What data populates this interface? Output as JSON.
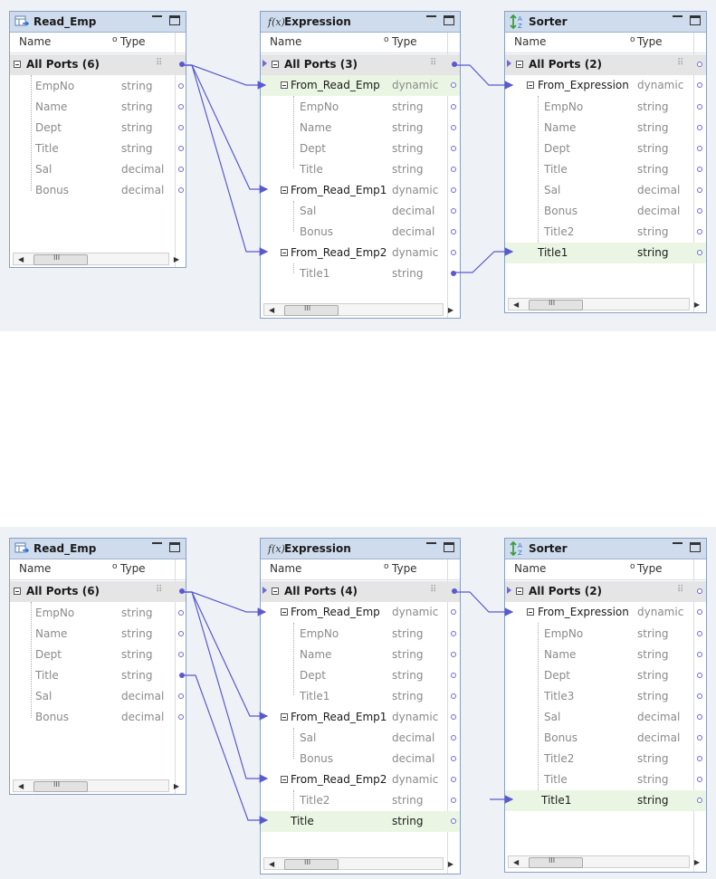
{
  "diagrams": [
    {
      "source": {
        "title": "Read_Emp",
        "header": {
          "name": "Name",
          "type": "Type"
        },
        "group": "All Ports (6)",
        "ports": [
          {
            "name": "EmpNo",
            "type": "string"
          },
          {
            "name": "Name",
            "type": "string"
          },
          {
            "name": "Dept",
            "type": "string"
          },
          {
            "name": "Title",
            "type": "string"
          },
          {
            "name": "Sal",
            "type": "decimal"
          },
          {
            "name": "Bonus",
            "type": "decimal"
          }
        ],
        "scroll_glyph": "III"
      },
      "expression": {
        "title": "Expression",
        "header": {
          "name": "Name",
          "type": "Type"
        },
        "group": "All Ports (3)",
        "rows": [
          {
            "name": "From_Read_Emp",
            "type": "dynamic"
          },
          {
            "name": "EmpNo",
            "type": "string"
          },
          {
            "name": "Name",
            "type": "string"
          },
          {
            "name": "Dept",
            "type": "string"
          },
          {
            "name": "Title",
            "type": "string"
          },
          {
            "name": "From_Read_Emp1",
            "type": "dynamic"
          },
          {
            "name": "Sal",
            "type": "decimal"
          },
          {
            "name": "Bonus",
            "type": "decimal"
          },
          {
            "name": "From_Read_Emp2",
            "type": "dynamic"
          },
          {
            "name": "Title1",
            "type": "string"
          }
        ],
        "scroll_glyph": "III"
      },
      "sorter": {
        "title": "Sorter",
        "header": {
          "name": "Name",
          "type": "Type"
        },
        "group": "All Ports (2)",
        "rows": [
          {
            "name": "From_Expression",
            "type": "dynamic"
          },
          {
            "name": "EmpNo",
            "type": "string"
          },
          {
            "name": "Name",
            "type": "string"
          },
          {
            "name": "Dept",
            "type": "string"
          },
          {
            "name": "Title",
            "type": "string"
          },
          {
            "name": "Sal",
            "type": "decimal"
          },
          {
            "name": "Bonus",
            "type": "decimal"
          },
          {
            "name": "Title2",
            "type": "string"
          },
          {
            "name": "Title1",
            "type": "string"
          }
        ],
        "scroll_glyph": "III"
      }
    },
    {
      "source": {
        "title": "Read_Emp",
        "header": {
          "name": "Name",
          "type": "Type"
        },
        "group": "All Ports (6)",
        "ports": [
          {
            "name": "EmpNo",
            "type": "string"
          },
          {
            "name": "Name",
            "type": "string"
          },
          {
            "name": "Dept",
            "type": "string"
          },
          {
            "name": "Title",
            "type": "string"
          },
          {
            "name": "Sal",
            "type": "decimal"
          },
          {
            "name": "Bonus",
            "type": "decimal"
          }
        ],
        "scroll_glyph": "III"
      },
      "expression": {
        "title": "Expression",
        "header": {
          "name": "Name",
          "type": "Type"
        },
        "group": "All Ports (4)",
        "rows": [
          {
            "name": "From_Read_Emp",
            "type": "dynamic"
          },
          {
            "name": "EmpNo",
            "type": "string"
          },
          {
            "name": "Name",
            "type": "string"
          },
          {
            "name": "Dept",
            "type": "string"
          },
          {
            "name": "Title1",
            "type": "string"
          },
          {
            "name": "From_Read_Emp1",
            "type": "dynamic"
          },
          {
            "name": "Sal",
            "type": "decimal"
          },
          {
            "name": "Bonus",
            "type": "decimal"
          },
          {
            "name": "From_Read_Emp2",
            "type": "dynamic"
          },
          {
            "name": "Title2",
            "type": "string"
          },
          {
            "name": "Title",
            "type": "string"
          }
        ],
        "scroll_glyph": "III"
      },
      "sorter": {
        "title": "Sorter",
        "header": {
          "name": "Name",
          "type": "Type"
        },
        "group": "All Ports (2)",
        "rows": [
          {
            "name": "From_Expression",
            "type": "dynamic"
          },
          {
            "name": "EmpNo",
            "type": "string"
          },
          {
            "name": "Name",
            "type": "string"
          },
          {
            "name": "Dept",
            "type": "string"
          },
          {
            "name": "Title3",
            "type": "string"
          },
          {
            "name": "Sal",
            "type": "decimal"
          },
          {
            "name": "Bonus",
            "type": "decimal"
          },
          {
            "name": "Title2",
            "type": "string"
          },
          {
            "name": "Title",
            "type": "string"
          },
          {
            "name": "Title1",
            "type": "string"
          }
        ],
        "scroll_glyph": "III"
      }
    }
  ],
  "colors": {
    "wire": "#5a5ad0",
    "highlight_row": "#eaf6e3",
    "group_row": "#e5e5e5"
  },
  "icons": {
    "source": "table-source-icon",
    "expression": "function-fx-icon",
    "sorter": "sort-az-icon"
  }
}
